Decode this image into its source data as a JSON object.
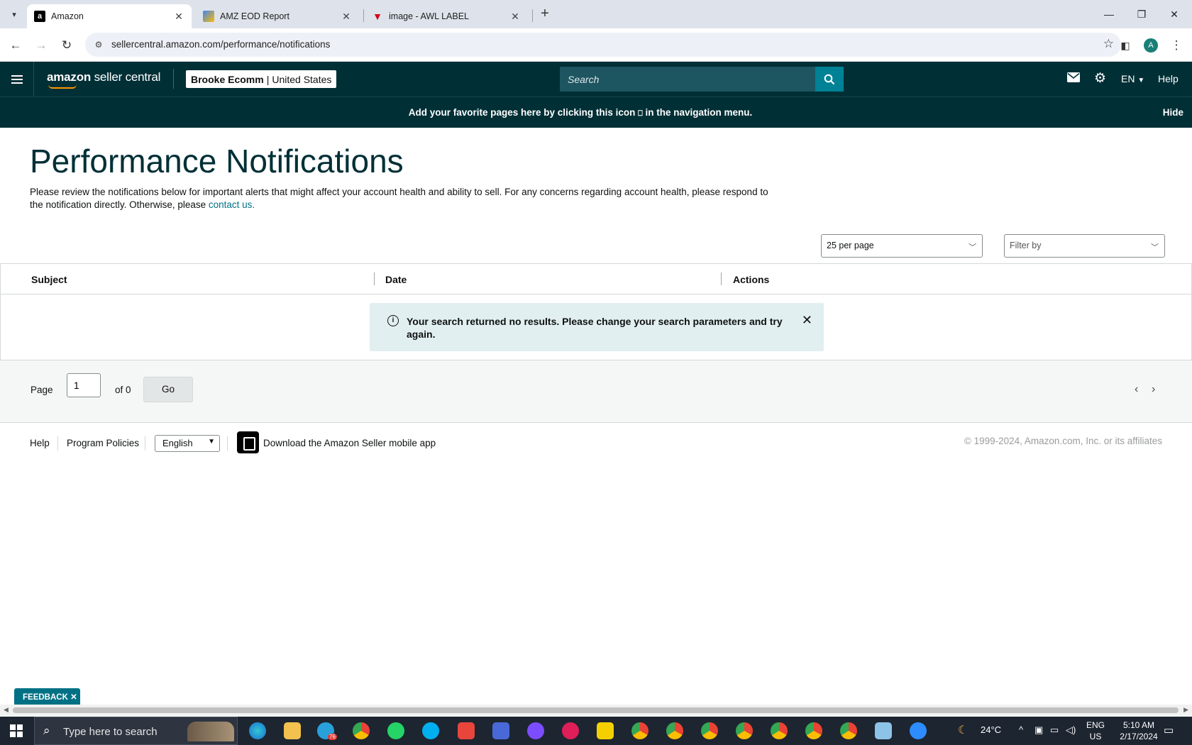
{
  "browser": {
    "tabs": [
      {
        "title": "Amazon",
        "favicon": "a",
        "active": true
      },
      {
        "title": "AMZ EOD Report",
        "favicon": "report-icon",
        "active": false
      },
      {
        "title": "image - AWL LABEL",
        "favicon": "label-icon",
        "active": false
      }
    ],
    "url": "sellercentral.amazon.com/performance/notifications",
    "profile_initial": "A"
  },
  "header": {
    "logo_bold": "amazon",
    "logo_text": " seller central",
    "account_name": "Brooke Ecomm",
    "account_sep": "|",
    "account_region": "United States",
    "search_placeholder": "Search",
    "lang": "EN",
    "help": "Help"
  },
  "favbar": {
    "message_pre": "Add your favorite pages here by clicking this icon",
    "message_post": "in the navigation menu.",
    "hide": "Hide"
  },
  "main": {
    "title": "Performance Notifications",
    "intro": "Please review the notifications below for important alerts that might affect your account health and ability to sell. For any concerns regarding account health, please respond to the notification directly. Otherwise, please",
    "contact_link": "contact us.",
    "per_page": "25 per page",
    "filter_placeholder": "Filter by",
    "columns": [
      "Subject",
      "Date",
      "Actions"
    ],
    "alert": "Your search returned no results. Please change your search parameters and try again."
  },
  "pager": {
    "page_label": "Page",
    "page_value": "1",
    "of_label": "of 0",
    "go": "Go"
  },
  "footer": {
    "help": "Help",
    "program_policies": "Program Policies",
    "language": "English",
    "app_text": "Download the Amazon Seller mobile app",
    "copyright": "© 1999-2024, Amazon.com, Inc. or its affiliates"
  },
  "feedback": "FEEDBACK",
  "taskbar": {
    "search_placeholder": "Type here to search",
    "weather": "24°C",
    "lang_top": "ENG",
    "lang_bottom": "US",
    "time": "5:10 AM",
    "date": "2/17/2024",
    "telegram_badge": "76"
  }
}
